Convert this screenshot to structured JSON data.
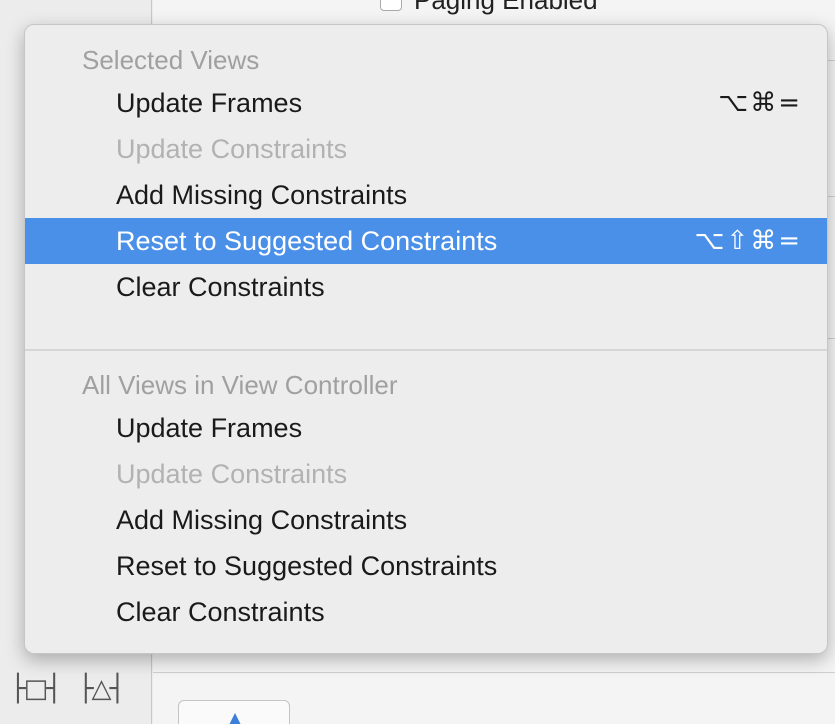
{
  "background": {
    "checkbox_label": "Paging Enabled",
    "bottom_icons": [
      {
        "icon": "align-icon",
        "glyph": "├□┤"
      },
      {
        "icon": "pin-icon",
        "glyph": "├△┤"
      }
    ]
  },
  "menu": {
    "sections": [
      {
        "header": "Selected Views",
        "items": [
          {
            "label": "Update Frames",
            "shortcut": "⌥⌘=",
            "enabled": true
          },
          {
            "label": "Update Constraints",
            "shortcut": "",
            "enabled": false
          },
          {
            "label": "Add Missing Constraints",
            "shortcut": "",
            "enabled": true
          },
          {
            "label": "Reset to Suggested Constraints",
            "shortcut": "⌥⇧⌘=",
            "enabled": true,
            "highlighted": true
          },
          {
            "label": "Clear Constraints",
            "shortcut": "",
            "enabled": true
          }
        ]
      },
      {
        "header": "All Views in View Controller",
        "items": [
          {
            "label": "Update Frames",
            "shortcut": "",
            "enabled": true
          },
          {
            "label": "Update Constraints",
            "shortcut": "",
            "enabled": false
          },
          {
            "label": "Add Missing Constraints",
            "shortcut": "",
            "enabled": true
          },
          {
            "label": "Reset to Suggested Constraints",
            "shortcut": "",
            "enabled": true
          },
          {
            "label": "Clear Constraints",
            "shortcut": "",
            "enabled": true
          }
        ]
      }
    ],
    "highlight_color": "#4a90e9"
  }
}
